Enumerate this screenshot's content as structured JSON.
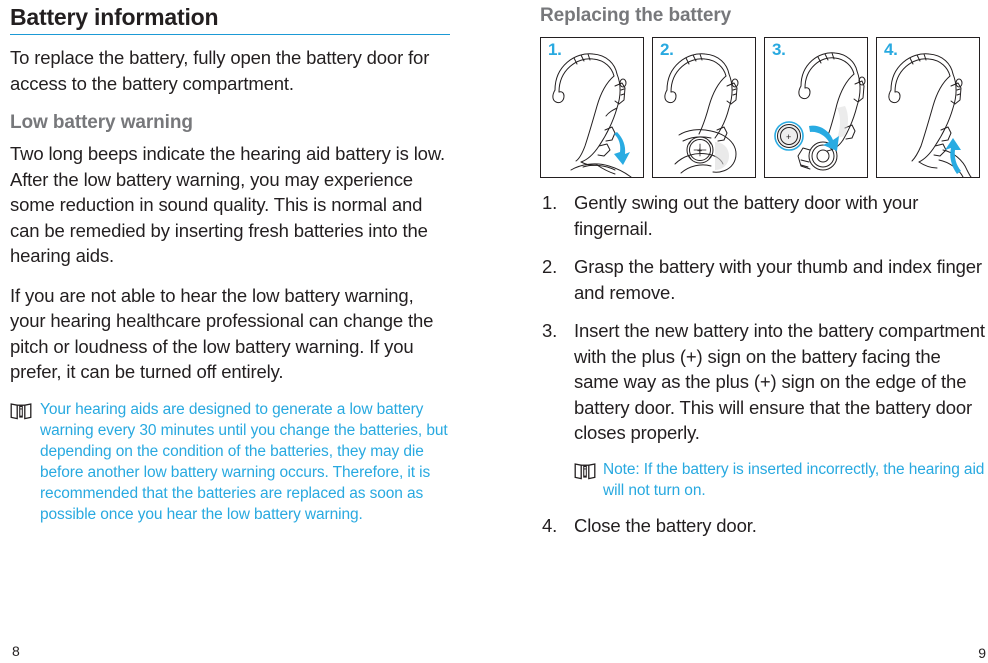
{
  "left": {
    "title": "Battery information",
    "intro": "To replace the battery, fully open the battery door for access to the battery compartment.",
    "subheading": "Low battery warning",
    "paragraph1": "Two long beeps indicate the hearing aid battery is low. After the low battery warning, you may experience some reduction in sound quality. This is normal and can be remedied by inserting fresh batteries into the hearing aids.",
    "paragraph2": "If you are not able to hear the low battery warning, your hearing healthcare professional can change the pitch or loudness of the low battery warning. If you prefer, it can be turned off entirely.",
    "note": "Your hearing aids are designed to generate a low battery warning every 30 minutes until you change the batteries, but depending on the condition of the batteries, they may die before another low battery warning occurs. Therefore, it is recommended that the batteries are replaced as soon as possible once you hear the low battery warning.",
    "note_icon": "instructions-manual-icon",
    "page_number": "8"
  },
  "right": {
    "title": "Replacing the battery",
    "figures": [
      {
        "label": "1.",
        "icon": "hearing-aid-open-battery-door-illustration"
      },
      {
        "label": "2.",
        "icon": "hearing-aid-grasp-battery-illustration"
      },
      {
        "label": "3.",
        "icon": "hearing-aid-insert-battery-illustration"
      },
      {
        "label": "4.",
        "icon": "hearing-aid-close-battery-door-illustration"
      }
    ],
    "steps": [
      {
        "num": "1.",
        "text": "Gently swing out the battery door with your fingernail."
      },
      {
        "num": "2.",
        "text": "Grasp the battery with your thumb and index finger and remove."
      },
      {
        "num": "3.",
        "text": "Insert the new battery into the battery compartment with the plus (+) sign on the battery facing the same way as the plus (+) sign on the edge of the battery door. This will ensure that the battery door closes properly."
      },
      {
        "num": "4.",
        "text": "Close the battery door."
      }
    ],
    "note": "Note: If the battery is inserted incorrectly, the hearing aid will not turn on.",
    "note_icon": "instructions-manual-icon",
    "page_number": "9"
  },
  "colors": {
    "accent_blue": "#28a9e0",
    "rule_blue": "#1b9ad6",
    "heading_gray": "#77787b",
    "text_black": "#231f20"
  }
}
